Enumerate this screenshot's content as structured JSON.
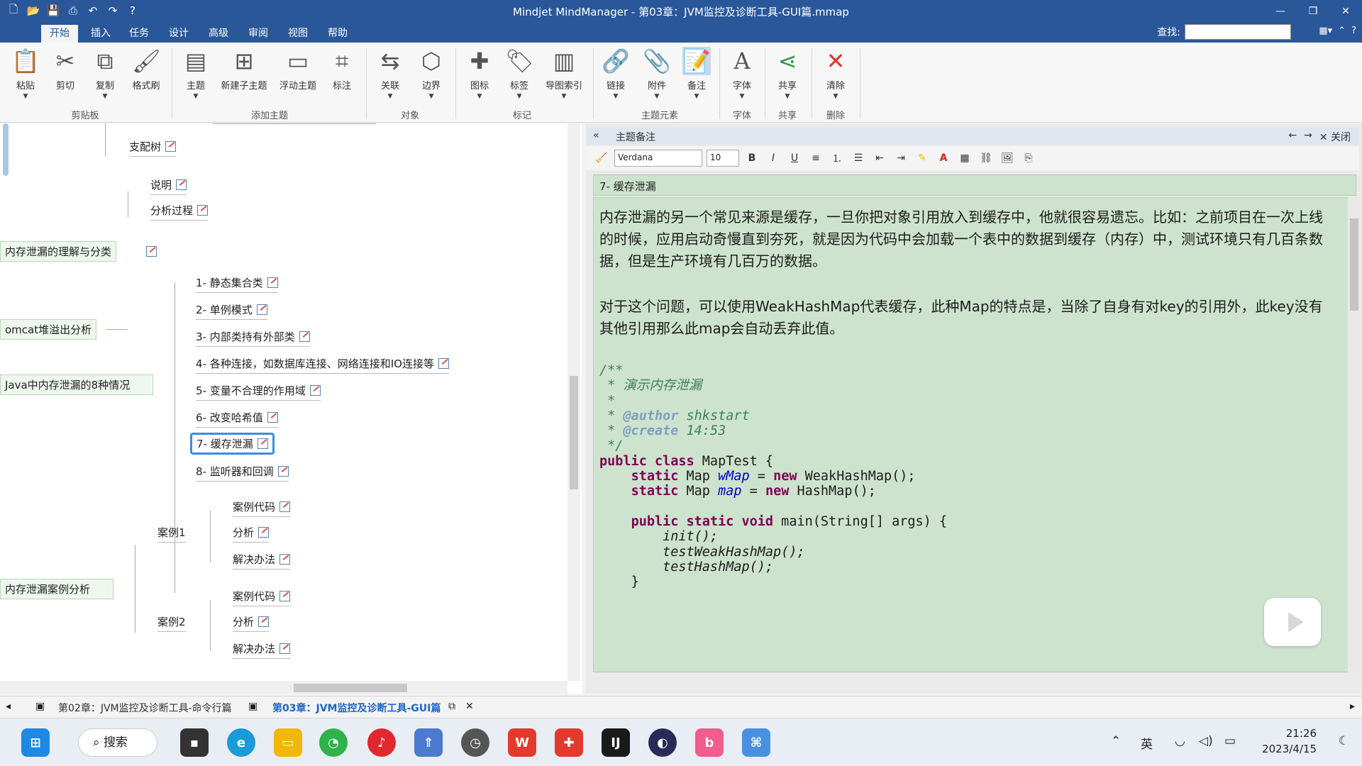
{
  "window": {
    "title": "Mindjet MindManager - 第03章：JVM监控及诊断工具-GUI篇.mmap"
  },
  "ribbon_tabs": [
    "开始",
    "插入",
    "任务",
    "设计",
    "高级",
    "审阅",
    "视图",
    "帮助"
  ],
  "find": {
    "label": "查找:",
    "value": ""
  },
  "ribbon": {
    "buttons": [
      "粘贴",
      "剪切",
      "复制",
      "格式刷",
      "主题",
      "新建子主题",
      "浮动主题",
      "标注",
      "关联",
      "边界",
      "图标",
      "标签",
      "导图索引",
      "链接",
      "附件",
      "备注",
      "字体",
      "共享",
      "清除"
    ],
    "groups": [
      "剪贴板",
      "添加主题",
      "对象",
      "标记",
      "主题元素",
      "字体",
      "共享",
      "删除"
    ]
  },
  "map": {
    "top_nodes": [
      "支配树",
      "说明",
      "分析过程"
    ],
    "main_topics": [
      "omcat堆溢出分析",
      "内存泄漏的理解与分类",
      "Java中内存泄漏的8种情况",
      "内存泄漏案例分析"
    ],
    "leak_cases": [
      "1- 静态集合类",
      "2- 单例模式",
      "3- 内部类持有外部类",
      "4- 各种连接，如数据库连接、网络连接和IO连接等",
      "5- 变量不合理的作用域",
      "6- 改变哈希值",
      "7- 缓存泄漏",
      "8- 监听器和回调"
    ],
    "case_groups": [
      "案例1",
      "案例2"
    ],
    "case_children": [
      "案例代码",
      "分析",
      "解决办法"
    ]
  },
  "notes": {
    "header": "主题备注",
    "close_label": "关闭",
    "font": "Verdana",
    "size": "10",
    "title": "7- 缓存泄漏",
    "para1": "内存泄漏的另一个常见来源是缓存，一旦你把对象引用放入到缓存中，他就很容易遗忘。比如：之前项目在一次上线的时候，应用启动奇慢直到夯死，就是因为代码中会加载一个表中的数据到缓存（内存）中，测试环境只有几百条数据，但是生产环境有几百万的数据。",
    "para2": "对于这个问题，可以使用WeakHashMap代表缓存，此种Map的特点是，当除了自身有对key的引用外，此key没有其他引用那么此map会自动丢弃此值。",
    "code": {
      "c1": "/**",
      "c2": " * 演示内存泄漏",
      "c3": " *",
      "c4_tag": "@author",
      "c4_val": " shkstart",
      "c5_tag": "@create",
      "c5_val": " 14:53",
      "c6": " */",
      "class_name": " MapTest {",
      "f1_type": " Map ",
      "f1_name": "wMap",
      "f1_init": " WeakHashMap();",
      "f2_name": "map",
      "f2_init": " HashMap();",
      "main_sig": " main(String[] args) {",
      "m1": "init();",
      "m2": "testWeakHashMap();",
      "m3": "testHashMap();",
      "close": "}"
    }
  },
  "doc_tabs": [
    "第02章：JVM监控及诊断工具-命令行篇",
    "第03章：JVM监控及诊断工具-GUI篇"
  ],
  "taskbar": {
    "search": "搜索",
    "ime": "英",
    "time": "21:26",
    "date": "2023/4/15"
  }
}
